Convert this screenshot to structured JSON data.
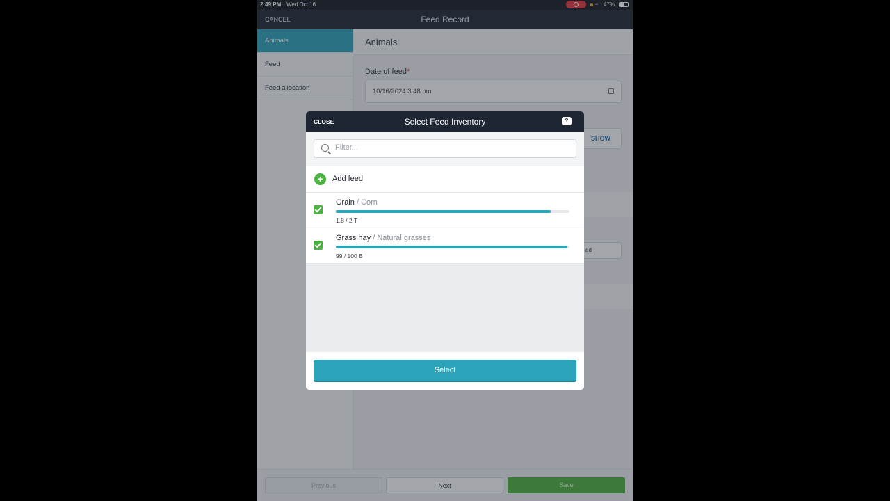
{
  "status_bar": {
    "time": "2:49 PM",
    "date": "Wed Oct 16",
    "battery": "47%"
  },
  "nav": {
    "cancel_label": "CANCEL",
    "title": "Feed Record"
  },
  "sidebar": {
    "items": [
      {
        "label": "Animals",
        "active": true
      },
      {
        "label": "Feed",
        "active": false
      },
      {
        "label": "Feed allocation",
        "active": false
      }
    ]
  },
  "main": {
    "section_title": "Animals",
    "date_label": "Date of feed",
    "required_mark": "*",
    "date_value": "10/16/2024 3:48 pm",
    "show_label": "SHOW",
    "partial_label": "ed"
  },
  "footer": {
    "previous_label": "Previous",
    "next_label": "Next",
    "save_label": "Save"
  },
  "modal": {
    "close_label": "CLOSE",
    "title": "Select Feed Inventory",
    "help_label": "?",
    "search_placeholder": "Filter...",
    "add_feed_label": "Add feed",
    "items": [
      {
        "name": "Grain",
        "separator": " / ",
        "type": "Corn",
        "quantity": "1.8  /  2 T",
        "fill_fraction": 0.92,
        "checked": true
      },
      {
        "name": "Grass hay",
        "separator": " / ",
        "type": "Natural grasses",
        "quantity": "99  /  100 B",
        "fill_fraction": 0.99,
        "checked": true
      }
    ],
    "select_label": "Select"
  },
  "colors": {
    "accent": "#2ba3b8",
    "success": "#49b13e",
    "nav_bg": "#1e2533"
  }
}
